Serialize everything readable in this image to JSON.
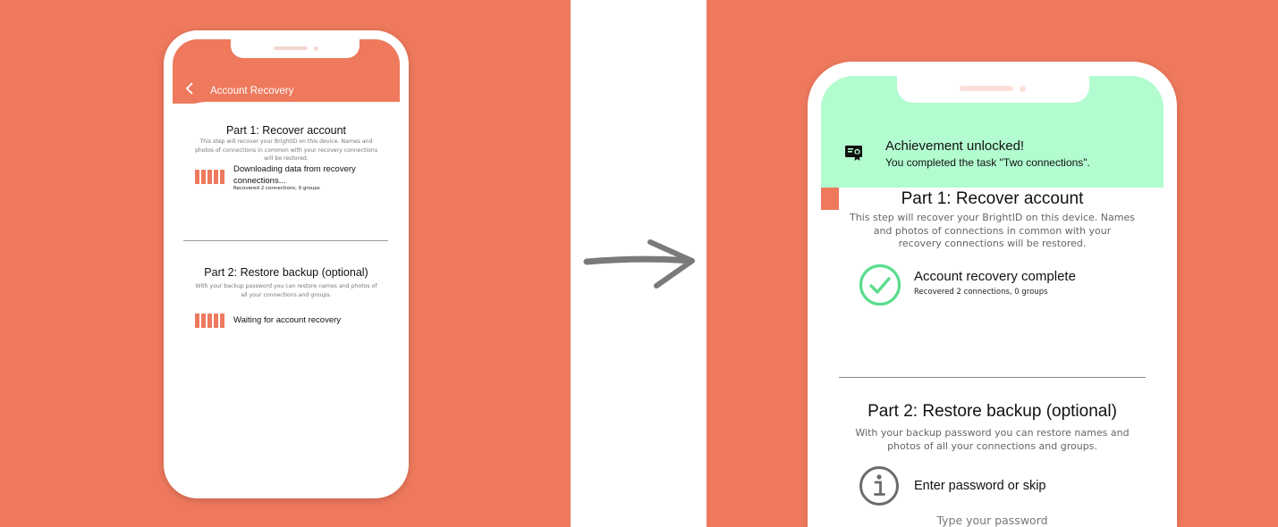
{
  "colors": {
    "brand_orange": "#EE795D",
    "achievement_green": "#B2FCCF",
    "success_green": "#5BDC8C",
    "arrow_gray": "#7a7a7a"
  },
  "before": {
    "header": {
      "back_icon": "chevron-left-icon",
      "title": "Account Recovery"
    },
    "part1": {
      "title": "Part 1: Recover account",
      "description": "This step will recover your BrightID on this device. Names and photos of connections in common with your recovery connections will be restored.",
      "status_line1": "Downloading data from recovery",
      "status_line2": "connections...",
      "sub": "Recovered 2 connections, 0 groups"
    },
    "part2": {
      "title": "Part 2: Restore backup (optional)",
      "description": "With your backup password you can restore names and photos of all your connections and groups.",
      "status": "Waiting for account recovery"
    }
  },
  "transition": {
    "icon": "arrow-right-icon"
  },
  "after": {
    "achievement": {
      "icon": "certificate-icon",
      "title": "Achievement unlocked!",
      "text": "You completed the task \"Two connections\"."
    },
    "part1": {
      "title": "Part 1: Recover account",
      "description_line1": "This step will recover your BrightID on this device. Names",
      "description_line2": "and photos of connections in common with your",
      "description_line3": "recovery connections will be restored.",
      "check_icon": "check-circle-icon",
      "status": "Account recovery complete",
      "sub": "Recovered 2 connections, 0 groups"
    },
    "part2": {
      "title": "Part 2: Restore backup (optional)",
      "description_line1": "With your backup password you can restore names and",
      "description_line2": "photos of all your connections and groups.",
      "info_icon": "info-circle-icon",
      "prompt": "Enter password or skip",
      "password_placeholder": "Type your password"
    }
  }
}
